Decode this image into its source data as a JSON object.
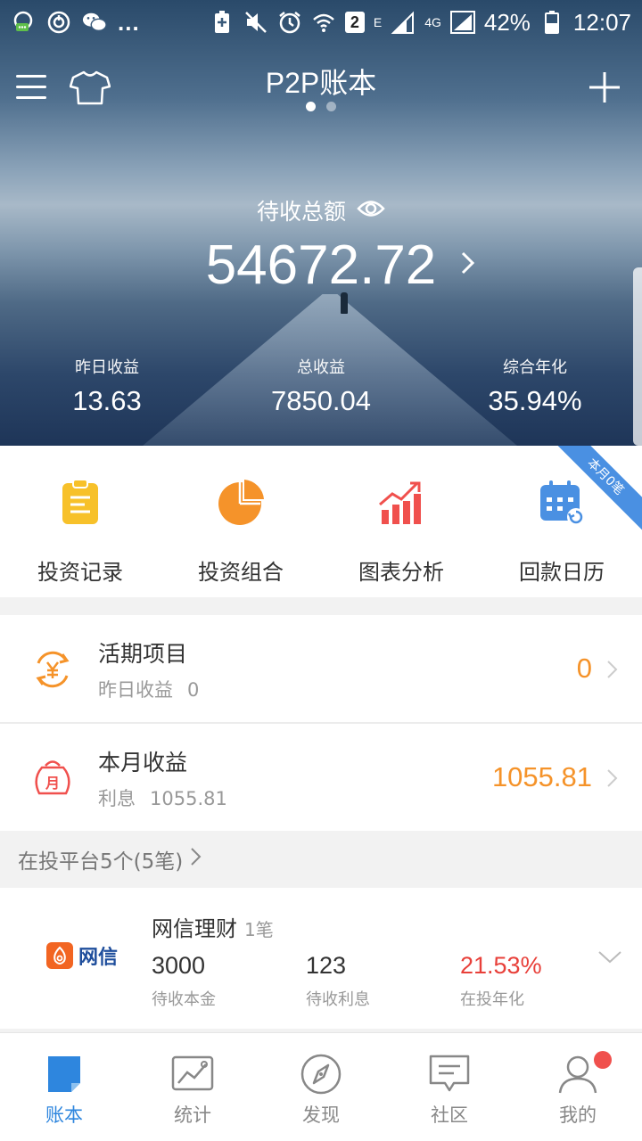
{
  "status_bar": {
    "overflow": "...",
    "sim_badge": "2",
    "network_e": "E",
    "network_4g": "4G",
    "battery": "42%",
    "time": "12:07"
  },
  "header": {
    "title": "P2P账本",
    "page_dots": 2,
    "active_dot": 0
  },
  "summary": {
    "label": "待收总额",
    "value": "54672.72"
  },
  "stats": [
    {
      "label": "昨日收益",
      "value": "13.63"
    },
    {
      "label": "总收益",
      "value": "7850.04"
    },
    {
      "label": "综合年化",
      "value": "35.94%"
    }
  ],
  "actions": [
    {
      "label": "投资记录",
      "icon": "clipboard-icon",
      "color": "#f7c12a"
    },
    {
      "label": "投资组合",
      "icon": "pie-chart-icon",
      "color": "#f5932a"
    },
    {
      "label": "图表分析",
      "icon": "bar-chart-icon",
      "color": "#f0504d"
    },
    {
      "label": "回款日历",
      "icon": "calendar-icon",
      "color": "#4a90e2"
    }
  ],
  "ribbon": "本月0笔",
  "current_item": {
    "title": "活期项目",
    "sub_label": "昨日收益",
    "sub_value": "0",
    "value": "0"
  },
  "monthly": {
    "title": "本月收益",
    "icon_text": "月",
    "sub_label": "利息",
    "sub_value": "1055.81",
    "value": "1055.81"
  },
  "section": {
    "label": "在投平台5个(5笔)"
  },
  "platform": {
    "logo_text": "网信",
    "name": "网信理财",
    "count": "1笔",
    "principal": "3000",
    "principal_label": "待收本金",
    "interest": "123",
    "interest_label": "待收利息",
    "rate": "21.53%",
    "rate_label": "在投年化"
  },
  "bottom_nav": [
    {
      "label": "账本",
      "icon": "ledger-icon",
      "active": true
    },
    {
      "label": "统计",
      "icon": "stats-icon",
      "active": false
    },
    {
      "label": "发现",
      "icon": "compass-icon",
      "active": false
    },
    {
      "label": "社区",
      "icon": "chat-icon",
      "active": false
    },
    {
      "label": "我的",
      "icon": "user-icon",
      "active": false
    }
  ],
  "colors": {
    "accent_orange": "#f5932a",
    "accent_blue": "#2e86de",
    "accent_red": "#e8403a"
  }
}
